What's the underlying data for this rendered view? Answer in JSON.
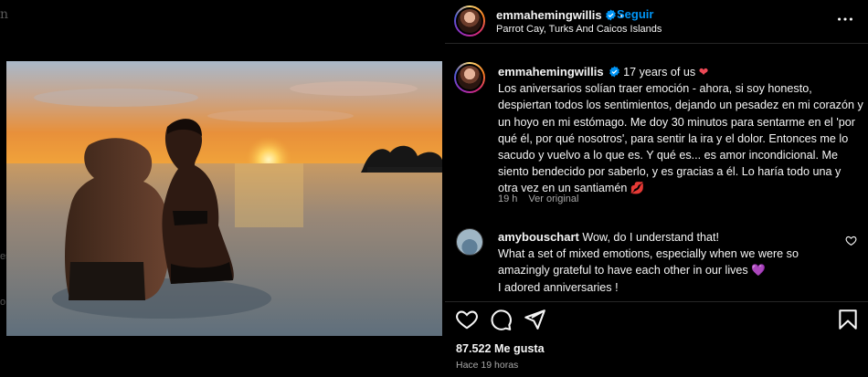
{
  "left_edge": {
    "glyph": "n",
    "marks": [
      "es",
      "o"
    ]
  },
  "post": {
    "username": "emmahemingwillis",
    "follow_label": "Seguir",
    "dot": "•",
    "location": "Parrot Cay, Turks And Caicos Islands",
    "more_icon": "more-horizontal-icon",
    "photo_alt": "sunset-beach-photo"
  },
  "caption": {
    "username": "emmahemingwillis",
    "headline": "17 years of us",
    "headline_emoji": "❤",
    "text": "Los aniversarios solían traer emoción - ahora, si soy honesto, despiertan todos los sentimientos, dejando un pesadez en mi corazón y un hoyo en mi estómago. Me doy 30 minutos para sentarme en el 'por qué él, por qué nosotros', para sentir la ira y el dolor. Entonces me lo sacudo y vuelvo a lo que es. Y qué es... es amor incondicional. Me siento bendecido por saberlo, y es gracias a él. Lo haría todo una y otra vez en un santiamén",
    "end_emoji": "💋",
    "time": "19 h",
    "translate_label": "Ver original"
  },
  "comment": {
    "username": "amybouschart",
    "line1": "Wow, do I understand that!",
    "line2": "What a set of mixed emotions, especially when we were so amazingly grateful to have each other in our lives",
    "emoji": "💜",
    "line3": "I adored anniversaries !"
  },
  "actions": {
    "icons": [
      "heart-icon",
      "comment-icon",
      "share-icon",
      "bookmark-icon"
    ]
  },
  "stats": {
    "likes": "87.522 Me gusta",
    "posted": "Hace 19 horas"
  },
  "colors": {
    "background": "#000000",
    "link_blue": "#0095f6",
    "verified_blue": "#0095f6",
    "heart_red": "#ed4956",
    "muted": "#a8a8a8"
  }
}
